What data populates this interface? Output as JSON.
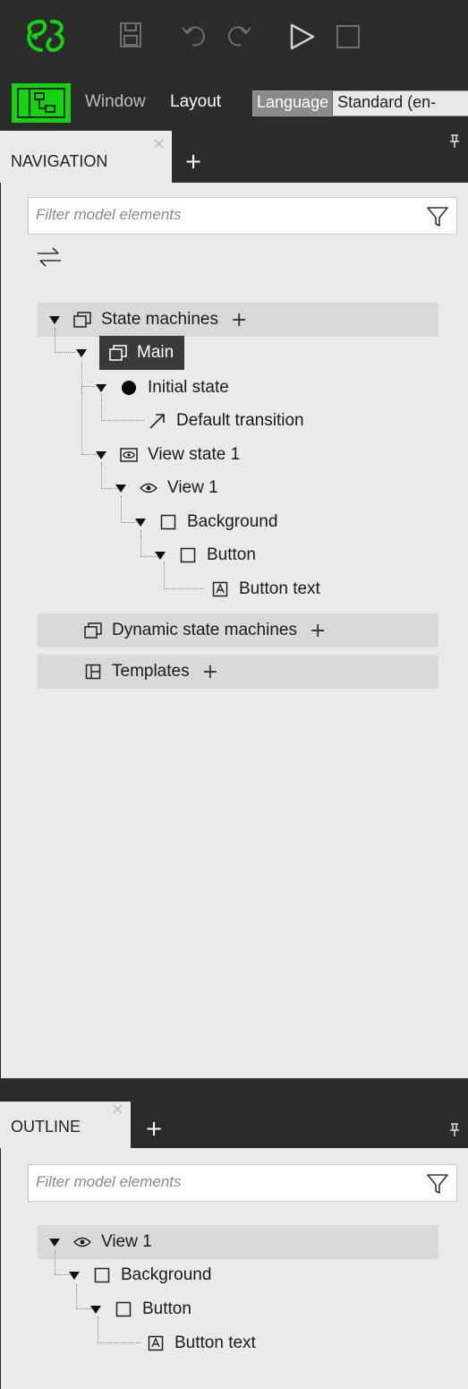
{
  "toolbar": {
    "icons": [
      "logo-icon",
      "save-icon",
      "undo-icon",
      "redo-icon",
      "play-icon",
      "stop-icon"
    ],
    "accent": "#13d40f"
  },
  "menubar": {
    "window_label": "Window",
    "layout_label": "Layout",
    "language_label": "Language",
    "language_value": "Standard (en-"
  },
  "navigation": {
    "tab_label": "NAVIGATION",
    "close_glyph": "×",
    "add_glyph": "+",
    "filter_placeholder": "Filter model elements",
    "sections": {
      "state_machines": "State machines",
      "dynamic_state_machines": "Dynamic state machines",
      "templates": "Templates"
    },
    "plus_glyph": "+",
    "tree": {
      "main": "Main",
      "initial_state": "Initial state",
      "default_transition": "Default transition",
      "view_state": "View state 1",
      "view": "View 1",
      "background": "Background",
      "button": "Button",
      "button_text": "Button text"
    }
  },
  "outline": {
    "tab_label": "OUTLINE",
    "close_glyph": "×",
    "add_glyph": "+",
    "filter_placeholder": "Filter model elements",
    "tree": {
      "view": "View 1",
      "background": "Background",
      "button": "Button",
      "button_text": "Button text"
    }
  }
}
